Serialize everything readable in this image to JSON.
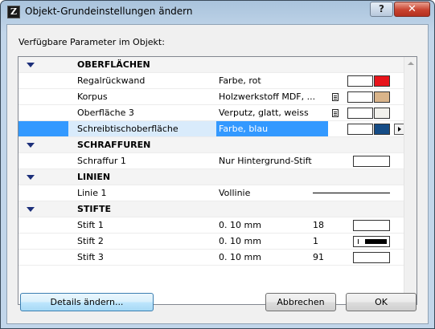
{
  "window": {
    "title": "Objekt-Grundeinstellungen ändern",
    "help_label": "?",
    "close_label": "✕",
    "app_icon_glyph": "Z"
  },
  "section_label": "Verfügbare Parameter im Objekt:",
  "groups": {
    "oberflaechen": "OBERFLÄCHEN",
    "schraffuren": "SCHRAFFUREN",
    "linien": "LINIEN",
    "stifte": "STIFTE"
  },
  "rows": {
    "regal": {
      "name": "Regalrückwand",
      "value": "Farbe, rot",
      "color": "#e8141b"
    },
    "korpus": {
      "name": "Korpus",
      "value": "Holzwerkstoff MDF, ...",
      "color": "#d9b48a"
    },
    "oberflaeche3": {
      "name": "Oberfläche 3",
      "value": "Verputz, glatt, weiss",
      "color": "#f2f1ec"
    },
    "schreibtisch": {
      "name": "Schreibtischoberfläche",
      "value": "Farbe, blau",
      "color": "#154c86"
    },
    "schraffur1": {
      "name": "Schraffur 1",
      "value": "Nur Hintergrund-Stift"
    },
    "linie1": {
      "name": "Linie 1",
      "value": "Vollinie"
    },
    "stift1": {
      "name": "Stift 1",
      "value": "0. 10 mm",
      "number": "18"
    },
    "stift2": {
      "name": "Stift 2",
      "value": "0. 10 mm",
      "number": "1"
    },
    "stift3": {
      "name": "Stift 3",
      "value": "0. 10 mm",
      "number": "91"
    }
  },
  "buttons": {
    "details": "Details ändern...",
    "cancel": "Abbrechen",
    "ok": "OK"
  },
  "icons": {
    "group_toggle": "collapse-triangle-icon",
    "document": "document-icon",
    "arrow": "play-arrow-icon"
  }
}
